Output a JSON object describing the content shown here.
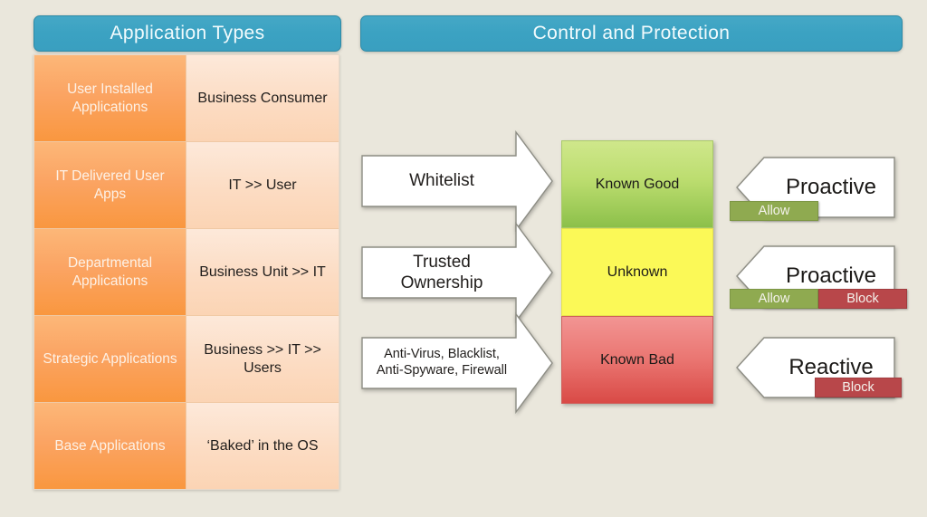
{
  "headers": {
    "application_types": "Application Types",
    "control_and_protection": "Control and Protection"
  },
  "app_table": {
    "rows": [
      {
        "type": "User Installed Applications",
        "owner": "Business Consumer"
      },
      {
        "type": "IT Delivered User Apps",
        "owner": "IT >> User"
      },
      {
        "type": "Departmental Applications",
        "owner": "Business Unit >> IT"
      },
      {
        "type": "Strategic Applications",
        "owner": "Business >> IT >> Users"
      },
      {
        "type": "Base Applications",
        "owner": "‘Baked’ in the OS"
      }
    ]
  },
  "flow_arrows": [
    {
      "label": "Whitelist"
    },
    {
      "label": "Trusted Ownership"
    },
    {
      "label": "Anti-Virus, Blacklist, Anti-Spyware, Firewall"
    }
  ],
  "classification_blocks": [
    {
      "label": "Known Good",
      "color": "#9ecb52"
    },
    {
      "label": "Unknown",
      "color": "#fbf957"
    },
    {
      "label": "Known Bad",
      "color": "#e05b57"
    }
  ],
  "outcomes": [
    {
      "label": "Proactive"
    },
    {
      "label": "Proactive"
    },
    {
      "label": "Reactive"
    }
  ],
  "badges": {
    "allow": "Allow",
    "block": "Block",
    "allow_color": "#8faa50",
    "block_color": "#b8474a"
  },
  "theme": {
    "background": "#eae7dc",
    "header_color": "#3ba2c2",
    "table_left_color": "#fba463",
    "table_right_color": "#fcdcc3"
  }
}
